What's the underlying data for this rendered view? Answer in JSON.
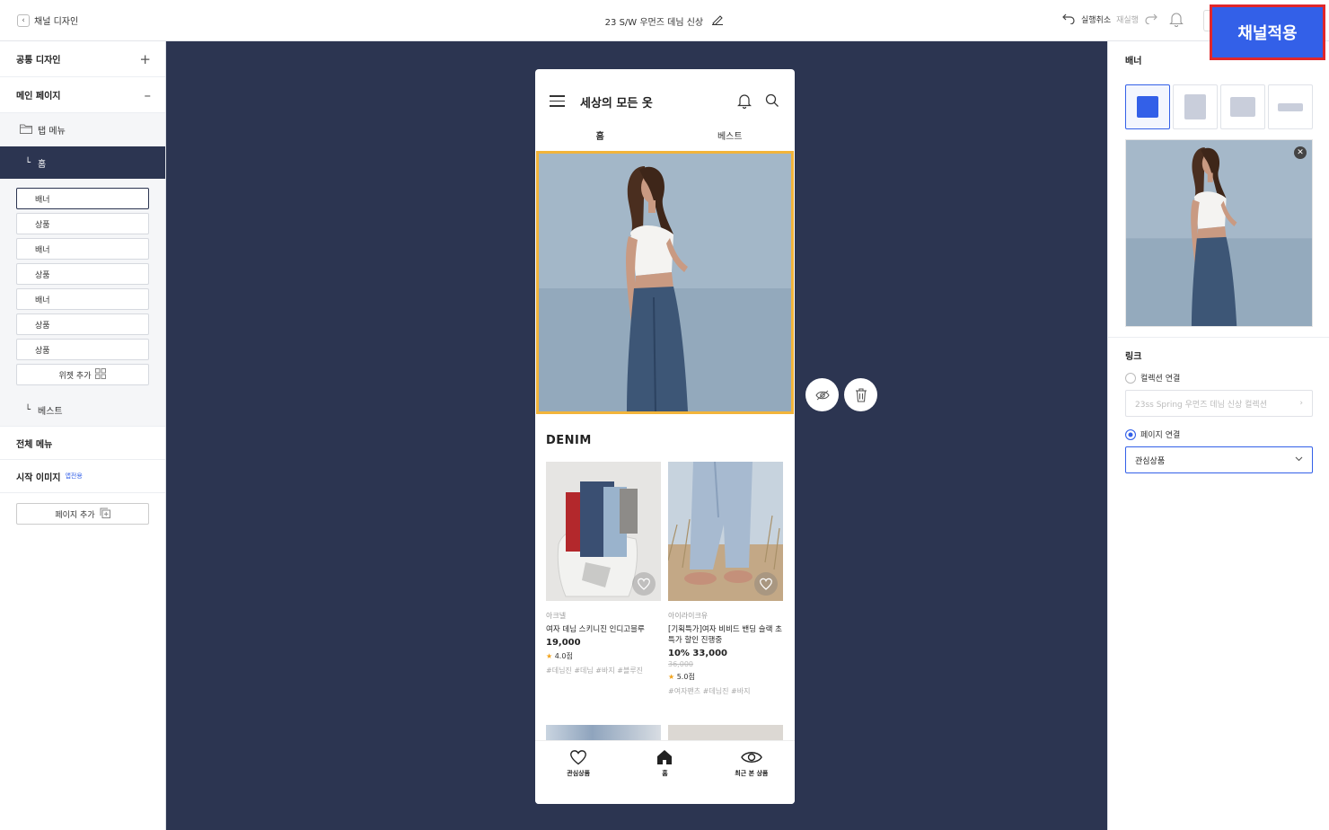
{
  "topbar": {
    "back_label": "채널 디자인",
    "doc_title": "23 S/W 우먼즈 데님 신상",
    "undo_label": "실행취소",
    "redo_label": "재실행",
    "apply_label": "채널적용"
  },
  "sidebar": {
    "common_design": "공통 디자인",
    "main_page": "메인 페이지",
    "tab_menu": "탭 메뉴",
    "home": "홈",
    "widgets": [
      "배너",
      "상품",
      "배너",
      "상품",
      "배너",
      "상품",
      "상품"
    ],
    "add_widget": "위젯 추가",
    "best": "베스트",
    "all_menu": "전체 메뉴",
    "start_image": "시작 이미지",
    "start_image_tag": "앱전용",
    "add_page": "페이지 추가"
  },
  "phone": {
    "title": "세상의 모든 옷",
    "tabs": [
      "홈",
      "베스트"
    ],
    "section_title": "DENIM",
    "products": [
      {
        "brand": "아크넬",
        "name": "여자 데님 스키니진 인디고블루",
        "price": "19,000",
        "original_price": "",
        "rating": "4.0점",
        "tags": "#데님진 #데님 #바지 #블루진"
      },
      {
        "brand": "아이라이크유",
        "name": "[기획특가]여자 비비드 밴딩 슬랙 초특가 할인 진행중",
        "price": "10% 33,000",
        "original_price": "36,000",
        "rating": "5.0점",
        "tags": "#여자팬츠 #데님진 #바지"
      }
    ],
    "nav": [
      "관심상품",
      "홈",
      "최근 본 상품"
    ]
  },
  "panel": {
    "banner_label": "배너",
    "link_label": "링크",
    "collection_link_label": "컬렉션 연결",
    "collection_placeholder": "23ss Spring 우먼즈 데님 신상 컬렉션",
    "page_link_label": "페이지 연결",
    "page_link_value": "관심상품",
    "selected_type_index": 0
  },
  "colors": {
    "accent": "#3360e8",
    "canvas": "#2c3551",
    "highlight": "#f2b43a",
    "apply_outline": "#e0272b"
  }
}
